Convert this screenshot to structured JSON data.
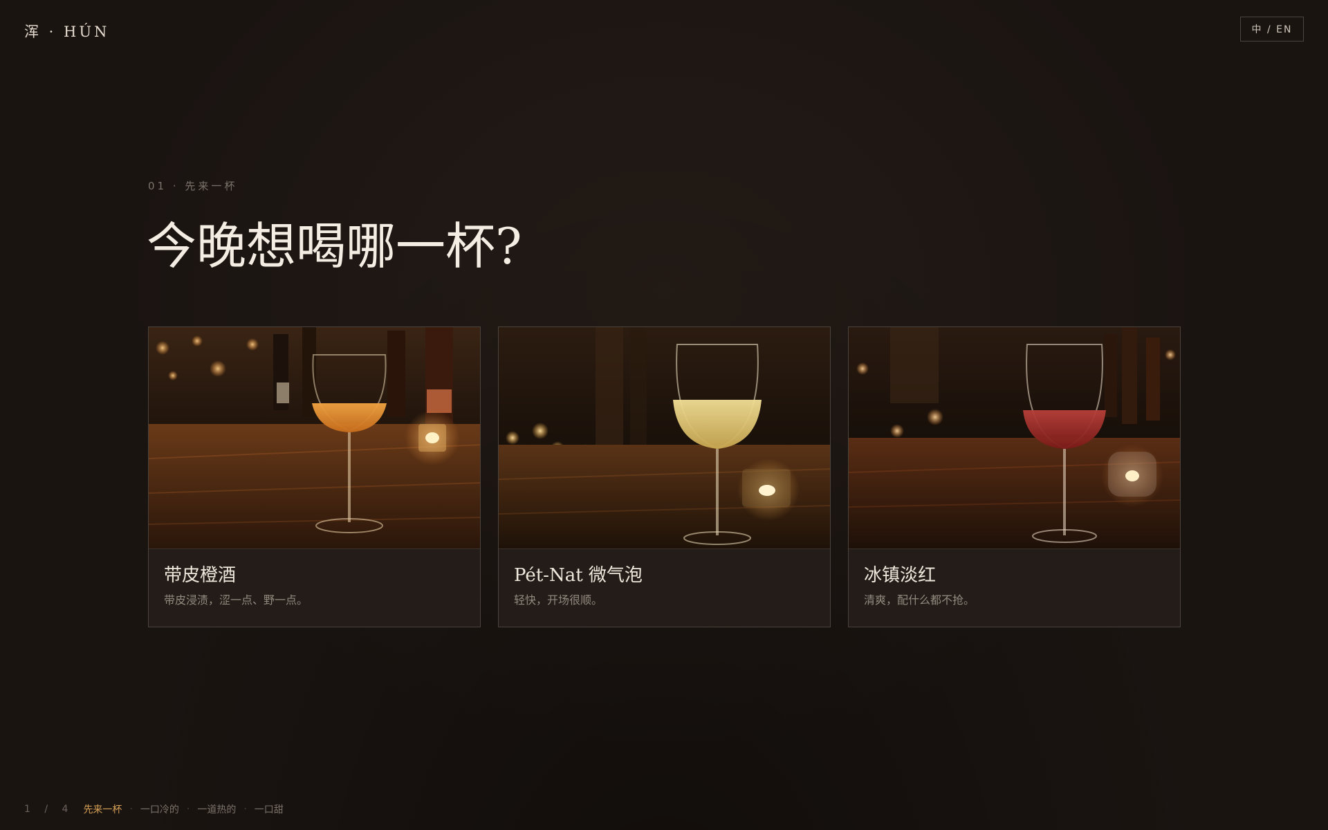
{
  "brand": {
    "logo_text": "浑 · HÚN"
  },
  "language_toggle": {
    "label": "中 / EN"
  },
  "section": {
    "eyebrow": "01 · 先来一杯",
    "title": "今晚想喝哪一杯?"
  },
  "cards": [
    {
      "title": "带皮橙酒",
      "description": "带皮浸渍，涩一点、野一点。",
      "wine_color": "#e8922e"
    },
    {
      "title": "Pét-Nat 微气泡",
      "description": "轻快，开场很顺。",
      "wine_color": "#e9d27a"
    },
    {
      "title": "冰镇淡红",
      "description": "清爽，配什么都不抢。",
      "wine_color": "#9c2a22"
    }
  ],
  "bottom_nav": {
    "pager": "1 / 4",
    "items": [
      {
        "label": "先来一杯",
        "active": true
      },
      {
        "label": "一口冷的",
        "active": false
      },
      {
        "label": "一道热的",
        "active": false
      },
      {
        "label": "一口甜",
        "active": false
      }
    ],
    "active_color": "#d6a055"
  },
  "colors": {
    "background": "#1a1411",
    "card_background": "#241c18",
    "card_border": "#4a423c",
    "title_text": "#f3ede3",
    "muted_text": "#938a80"
  }
}
